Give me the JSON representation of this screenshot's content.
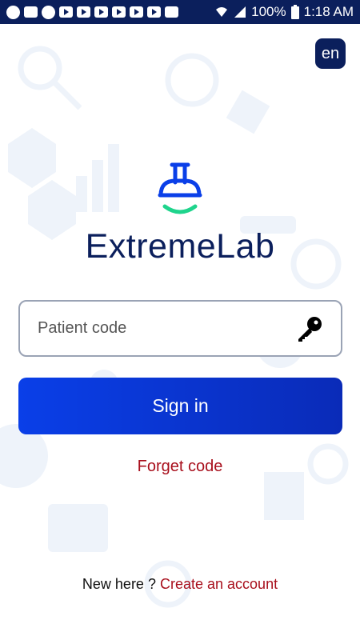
{
  "status_bar": {
    "battery": "100%",
    "time": "1:18 AM",
    "left_icons": [
      "sync-icon",
      "image-icon",
      "chat-icon",
      "youtube-icon",
      "youtube-icon",
      "youtube-icon",
      "youtube-icon",
      "youtube-icon",
      "youtube-icon",
      "mail-icon"
    ],
    "right_icons": [
      "wifi-icon",
      "signal-icon"
    ]
  },
  "language": {
    "label": "en"
  },
  "brand": {
    "name": "ExtremeLab",
    "logo": "flask-icon"
  },
  "login": {
    "code_placeholder": "Patient code",
    "code_value": "",
    "key_icon": "key-icon",
    "signin_label": "Sign in",
    "forget_label": "Forget code"
  },
  "footer": {
    "prompt": "New here ?",
    "create_label": "Create an account"
  },
  "colors": {
    "primary": "#0b1f5c",
    "button": "#0a3fe8",
    "link": "#a80f1c",
    "logo_accent": "#1fd48c"
  }
}
